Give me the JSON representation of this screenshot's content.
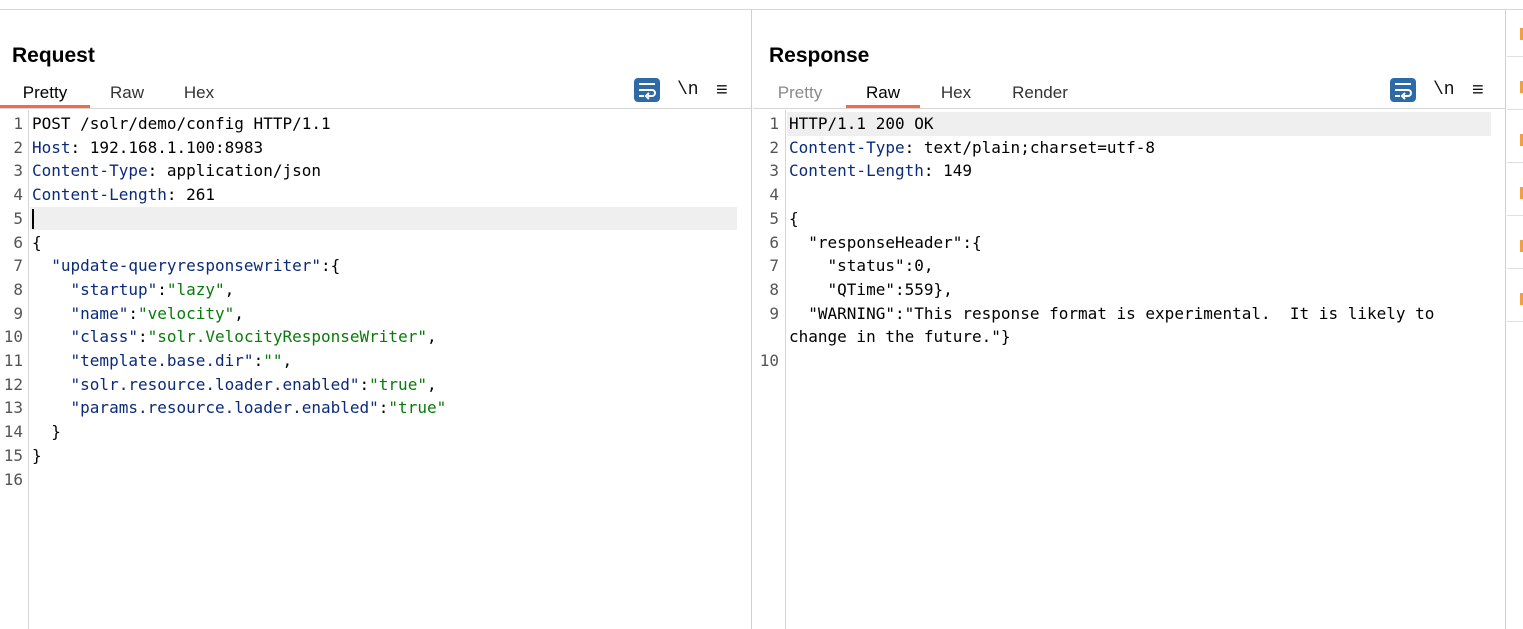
{
  "request": {
    "title": "Request",
    "tabs": [
      {
        "label": "Pretty",
        "active": true
      },
      {
        "label": "Raw",
        "active": false
      },
      {
        "label": "Hex",
        "active": false
      }
    ],
    "newline_toggle": "\\n",
    "menu_icon": "≡",
    "line_numbers": [
      "1",
      "2",
      "3",
      "4",
      "5",
      "6",
      "7",
      "8",
      "9",
      "10",
      "11",
      "12",
      "13",
      "14",
      "15",
      "16"
    ],
    "lines": [
      [
        {
          "t": "POST /solr/demo/config HTTP/1.1",
          "c": ""
        }
      ],
      [
        {
          "t": "Host",
          "c": "k"
        },
        {
          "t": ": 192.168.1.100:8983",
          "c": ""
        }
      ],
      [
        {
          "t": "Content-Type",
          "c": "k"
        },
        {
          "t": ": application/json",
          "c": ""
        }
      ],
      [
        {
          "t": "Content-Length",
          "c": "k"
        },
        {
          "t": ": 261",
          "c": ""
        }
      ],
      [],
      [
        {
          "t": "{",
          "c": ""
        }
      ],
      [
        {
          "t": "  ",
          "c": ""
        },
        {
          "t": "\"update-queryresponsewriter\"",
          "c": "k"
        },
        {
          "t": ":{",
          "c": ""
        }
      ],
      [
        {
          "t": "    ",
          "c": ""
        },
        {
          "t": "\"startup\"",
          "c": "k"
        },
        {
          "t": ":",
          "c": ""
        },
        {
          "t": "\"lazy\"",
          "c": "s"
        },
        {
          "t": ",",
          "c": ""
        }
      ],
      [
        {
          "t": "    ",
          "c": ""
        },
        {
          "t": "\"name\"",
          "c": "k"
        },
        {
          "t": ":",
          "c": ""
        },
        {
          "t": "\"velocity\"",
          "c": "s"
        },
        {
          "t": ",",
          "c": ""
        }
      ],
      [
        {
          "t": "    ",
          "c": ""
        },
        {
          "t": "\"class\"",
          "c": "k"
        },
        {
          "t": ":",
          "c": ""
        },
        {
          "t": "\"solr.VelocityResponseWriter\"",
          "c": "s"
        },
        {
          "t": ",",
          "c": ""
        }
      ],
      [
        {
          "t": "    ",
          "c": ""
        },
        {
          "t": "\"template.base.dir\"",
          "c": "k"
        },
        {
          "t": ":",
          "c": ""
        },
        {
          "t": "\"\"",
          "c": "s"
        },
        {
          "t": ",",
          "c": ""
        }
      ],
      [
        {
          "t": "    ",
          "c": ""
        },
        {
          "t": "\"solr.resource.loader.enabled\"",
          "c": "k"
        },
        {
          "t": ":",
          "c": ""
        },
        {
          "t": "\"true\"",
          "c": "s"
        },
        {
          "t": ",",
          "c": ""
        }
      ],
      [
        {
          "t": "    ",
          "c": ""
        },
        {
          "t": "\"params.resource.loader.enabled\"",
          "c": "k"
        },
        {
          "t": ":",
          "c": ""
        },
        {
          "t": "\"true\"",
          "c": "s"
        }
      ],
      [
        {
          "t": "  }",
          "c": ""
        }
      ],
      [
        {
          "t": "}",
          "c": ""
        }
      ],
      []
    ]
  },
  "response": {
    "title": "Response",
    "tabs": [
      {
        "label": "Pretty",
        "active": false
      },
      {
        "label": "Raw",
        "active": true
      },
      {
        "label": "Hex",
        "active": false
      },
      {
        "label": "Render",
        "active": false
      }
    ],
    "newline_toggle": "\\n",
    "menu_icon": "≡",
    "line_numbers": [
      "1",
      "2",
      "3",
      "4",
      "5",
      "6",
      "7",
      "8",
      "9",
      "",
      "10"
    ],
    "lines": [
      [
        {
          "t": "HTTP/1.1 200 OK",
          "c": ""
        }
      ],
      [
        {
          "t": "Content-Type",
          "c": "k"
        },
        {
          "t": ": text/plain;charset=utf-8",
          "c": ""
        }
      ],
      [
        {
          "t": "Content-Length",
          "c": "k"
        },
        {
          "t": ": 149",
          "c": ""
        }
      ],
      [],
      [
        {
          "t": "{",
          "c": ""
        }
      ],
      [
        {
          "t": "  \"responseHeader\":{",
          "c": ""
        }
      ],
      [
        {
          "t": "    \"status\":0,",
          "c": ""
        }
      ],
      [
        {
          "t": "    \"QTime\":559},",
          "c": ""
        }
      ],
      [
        {
          "t": "  \"WARNING\":\"This response format is experimental.  It is likely to",
          "c": ""
        }
      ],
      [
        {
          "t": "change in the future.\"}",
          "c": ""
        }
      ],
      []
    ]
  },
  "colors": {
    "accent": "#ee6c4d",
    "key": "#0b2a7a",
    "string": "#0a7a0a",
    "button_blue": "#2e6aa6"
  },
  "icons": {
    "wrap": "word-wrap-icon",
    "layout": [
      "side-by-side-layout-icon",
      "stacked-layout-icon",
      "single-pane-layout-icon"
    ]
  }
}
